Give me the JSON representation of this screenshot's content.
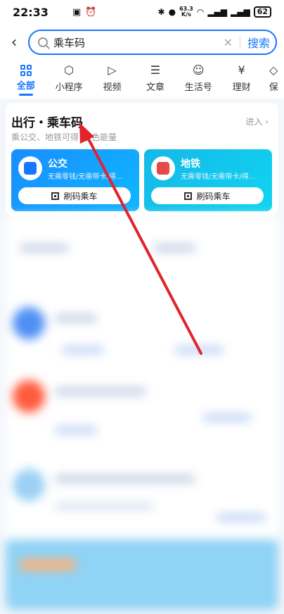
{
  "status": {
    "time": "22:33",
    "speed_top": "63.3",
    "speed_bottom": "K/s",
    "battery": "62"
  },
  "search": {
    "query": "乘车码",
    "button": "搜索"
  },
  "tabs": [
    {
      "label": "全部",
      "icon": "grid-icon"
    },
    {
      "label": "小程序",
      "icon": "mini-program-icon"
    },
    {
      "label": "视频",
      "icon": "video-icon"
    },
    {
      "label": "文章",
      "icon": "article-icon"
    },
    {
      "label": "生活号",
      "icon": "life-account-icon"
    },
    {
      "label": "理财",
      "icon": "finance-icon"
    },
    {
      "label": "保",
      "icon": "insurance-icon"
    }
  ],
  "card": {
    "title": "出行・乘车码",
    "subtitle": "乘公交、地铁可得",
    "subtitle_tail": "色能量",
    "more": "进入",
    "bus": {
      "name": "公交",
      "desc": "无需零钱/无需带卡/得...",
      "button": "刷码乘车"
    },
    "metro": {
      "name": "地铁",
      "desc": "无需零钱/无需带卡/得...",
      "button": "刷码乘车"
    }
  },
  "colors": {
    "accent": "#1677ff",
    "arrow": "#e0242b"
  }
}
